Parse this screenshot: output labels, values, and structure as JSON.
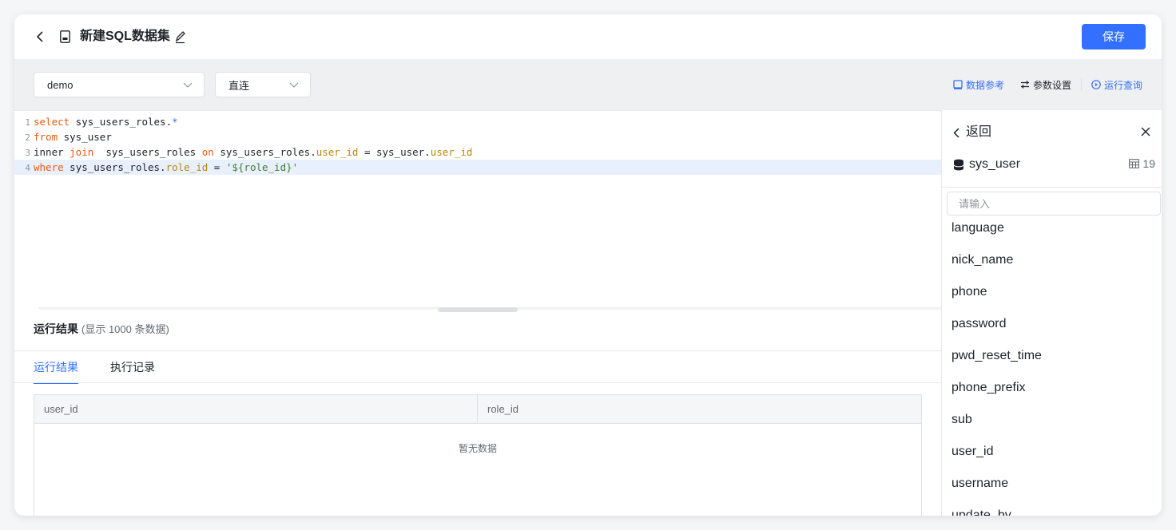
{
  "header": {
    "title": "新建SQL数据集",
    "save_label": "保存"
  },
  "toolbar": {
    "datasource": "demo",
    "mode": "直连",
    "links": {
      "data_reference": "数据参考",
      "param_settings": "参数设置",
      "run_query": "运行查询"
    }
  },
  "editor": {
    "line_numbers": [
      "1",
      "2",
      "3",
      "4"
    ],
    "lines": [
      [
        {
          "t": "select",
          "c": "kw"
        },
        {
          "t": " sys_users_roles.",
          "c": ""
        },
        {
          "t": "*",
          "c": "op"
        }
      ],
      [
        {
          "t": "from",
          "c": "kw"
        },
        {
          "t": " sys_user",
          "c": ""
        }
      ],
      [
        {
          "t": "inner ",
          "c": ""
        },
        {
          "t": "join",
          "c": "kw"
        },
        {
          "t": "  sys_users_roles ",
          "c": ""
        },
        {
          "t": "on",
          "c": "kw"
        },
        {
          "t": " sys_users_roles.",
          "c": ""
        },
        {
          "t": "user_id",
          "c": "fld"
        },
        {
          "t": " = sys_user.",
          "c": ""
        },
        {
          "t": "user_id",
          "c": "fld"
        }
      ],
      [
        {
          "t": "where",
          "c": "kw"
        },
        {
          "t": " sys_users_roles.",
          "c": ""
        },
        {
          "t": "role_id",
          "c": "fld"
        },
        {
          "t": " = ",
          "c": ""
        },
        {
          "t": "'${role_id}'",
          "c": "str"
        }
      ]
    ],
    "active_line": 4
  },
  "results": {
    "title": "运行结果",
    "subtitle": "(显示 1000 条数据)",
    "tabs": [
      {
        "label": "运行结果",
        "active": true
      },
      {
        "label": "执行记录",
        "active": false
      }
    ],
    "columns": [
      "user_id",
      "role_id"
    ],
    "empty_text": "暂无数据"
  },
  "panel": {
    "back_label": "返回",
    "table_name": "sys_user",
    "field_count": "19",
    "search_placeholder": "请输入",
    "fields": [
      "language",
      "nick_name",
      "phone",
      "password",
      "pwd_reset_time",
      "phone_prefix",
      "sub",
      "user_id",
      "username",
      "update_by"
    ]
  },
  "colors": {
    "accent": "#3370ff",
    "keyword": "#e8590c",
    "field": "#b8860b",
    "string": "#3f7d2c"
  }
}
